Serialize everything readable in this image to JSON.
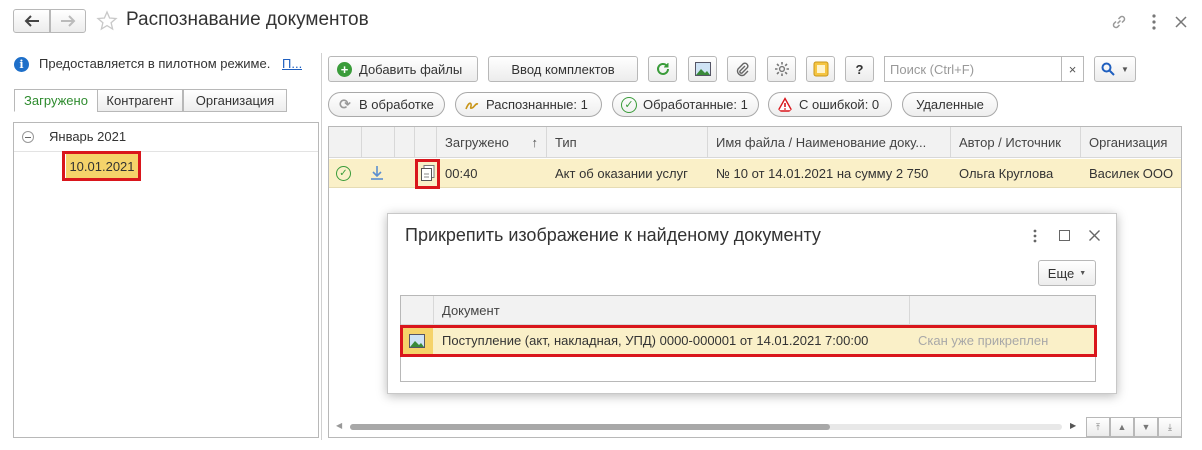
{
  "window": {
    "title": "Распознавание документов",
    "back_icon": "arrow-left-icon",
    "forward_icon": "arrow-right-icon",
    "star_icon": "star-icon",
    "link_icon": "link-icon",
    "menu_icon": "more-vert-icon",
    "close_icon": "close-icon"
  },
  "left": {
    "info_text": "Предоставляется в пилотном режиме.",
    "info_link": "П...",
    "tabs": [
      "Загружено",
      "Контрагент",
      "Организация"
    ],
    "tree_group": "Январь 2021",
    "tree_item": "10.01.2021"
  },
  "toolbar": {
    "add_files": "Добавить файлы",
    "input_set": "Ввод комплектов",
    "help": "?",
    "search_placeholder": "Поиск (Ctrl+F)",
    "search_clear": "×"
  },
  "filters": {
    "processing": "В обработке",
    "recognized": "Распознанные: 1",
    "processed": "Обработанные: 1",
    "errors": "С ошибкой: 0",
    "deleted": "Удаленные"
  },
  "table": {
    "columns": [
      "Загружено",
      "Тип",
      "Имя файла / Наименование доку...",
      "Автор / Источник",
      "Организация"
    ],
    "sort_indicator": "↑",
    "rows": [
      {
        "time": "00:40",
        "type": "Акт об оказании услуг",
        "name": "№ 10 от 14.01.2021 на сумму 2 750",
        "author": "Ольга Круглова",
        "org": "Василек ООО"
      }
    ]
  },
  "dialog": {
    "title": "Прикрепить изображение к найденому документу",
    "more_button": "Еще",
    "columns": [
      "Документ",
      ""
    ],
    "rows": [
      {
        "document": "Поступление (акт, накладная, УПД) 0000-000001 от 14.01.2021 7:00:00",
        "status": "Скан уже прикреплен"
      }
    ]
  },
  "colors": {
    "accent_green": "#3a9c3a",
    "selection_yellow": "#faf0c8",
    "highlight_border": "#d9161c",
    "error_red": "#d9161c"
  }
}
